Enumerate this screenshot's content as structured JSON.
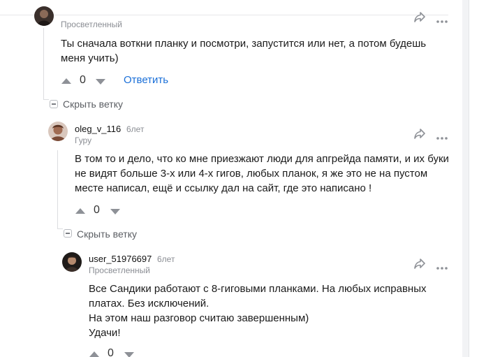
{
  "comments": [
    {
      "username": "",
      "age": "",
      "rank": "Просветленный",
      "text": [
        "Ты сначала воткни планку и посмотри, запустится или нет, а потом будешь меня учить)"
      ],
      "votes": "0",
      "reply_label": "Ответить"
    },
    {
      "username": "oleg_v_116",
      "age": "6лет",
      "rank": "Гуру",
      "text": [
        "В том то и дело, что ко мне приезжают люди для апгрейда памяти, и их буки не видят больше 3-х или 4-х гигов, любых планок, я же это не на пустом месте написал, ещё и ссылку дал на сайт, где это написано !"
      ],
      "votes": "0"
    },
    {
      "username": "user_51976697",
      "age": "6лет",
      "rank": "Просветленный",
      "text": [
        "Все Сандики работают с 8-гиговыми планками. На любых исправных платах. Без исключений.",
        "На этом наш разговор считаю завершенным)",
        "Удачи!"
      ],
      "votes": "0"
    }
  ],
  "hide_branch_label": "Скрыть ветку",
  "colors": {
    "link": "#1a6fd8",
    "muted": "#8b8e94",
    "icon": "#8e9197"
  }
}
